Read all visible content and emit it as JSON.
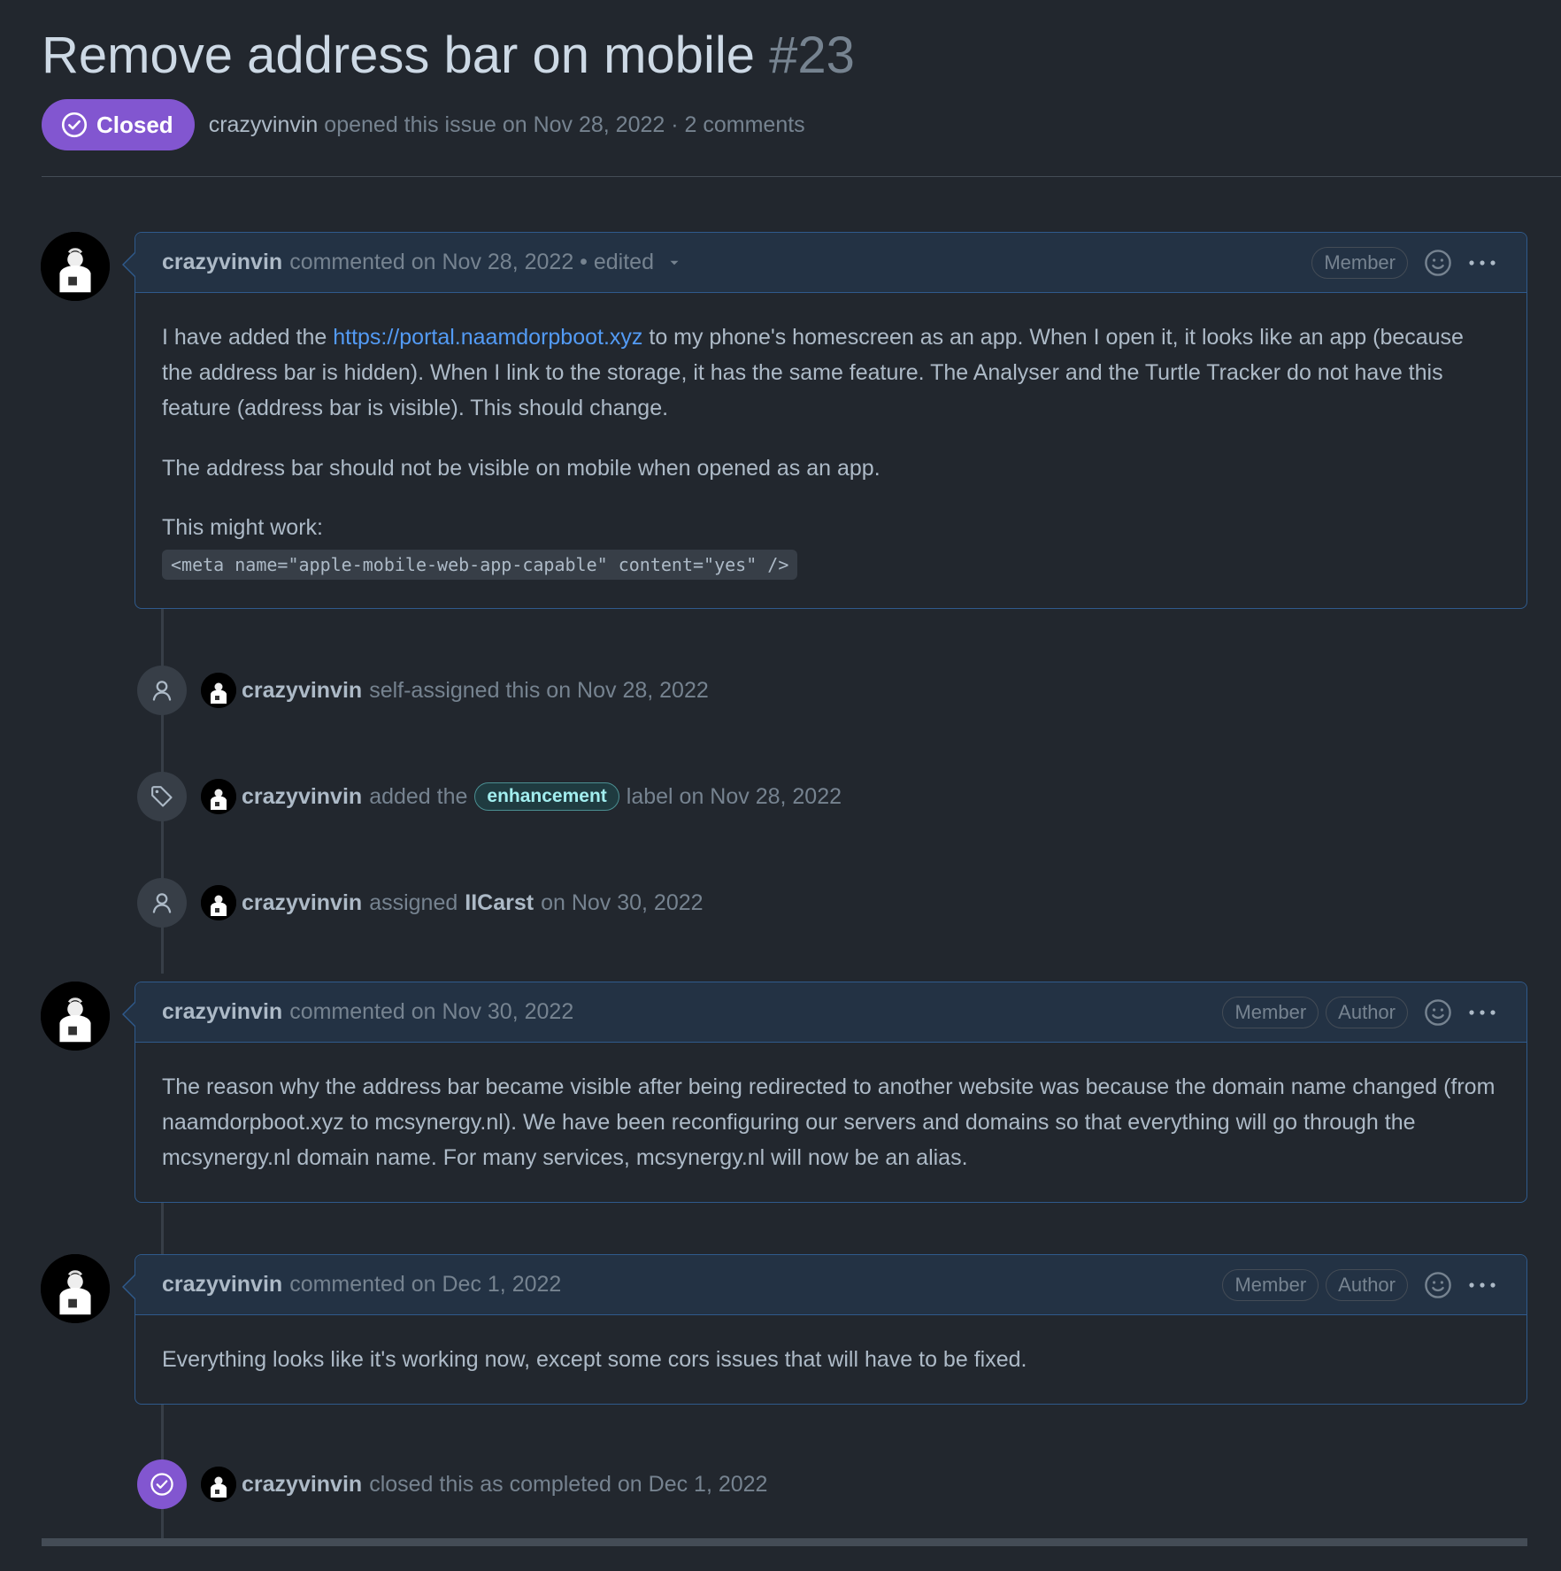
{
  "issue": {
    "title": "Remove address bar on mobile",
    "number": "#23",
    "state": "Closed",
    "author": "crazyvinvin",
    "meta": "opened this issue on Nov 28, 2022 · 2 comments"
  },
  "comments": [
    {
      "author": "crazyvinvin",
      "timestamp": "commented on Nov 28, 2022 • edited",
      "roles": [
        "Member"
      ],
      "body": {
        "p1_before": "I have added the ",
        "link": "https://portal.naamdorpboot.xyz",
        "p1_after": " to my phone's homescreen as an app. When I open it, it looks like an app (because the address bar is hidden). When I link to the storage, it has the same feature. The Analyser and the Turtle Tracker do not have this feature (address bar is visible). This should change.",
        "p2": "The address bar should not be visible on mobile when opened as an app.",
        "p3": "This might work:",
        "code": "<meta name=\"apple-mobile-web-app-capable\" content=\"yes\" />"
      }
    },
    {
      "author": "crazyvinvin",
      "timestamp": "commented on Nov 30, 2022",
      "roles": [
        "Member",
        "Author"
      ],
      "body": "The reason why the address bar became visible after being redirected to another website was because the domain name changed (from naamdorpboot.xyz to mcsynergy.nl). We have been reconfiguring our servers and domains so that everything will go through the mcsynergy.nl domain name. For many services, mcsynergy.nl will now be an alias."
    },
    {
      "author": "crazyvinvin",
      "timestamp": "commented on Dec 1, 2022",
      "roles": [
        "Member",
        "Author"
      ],
      "body": "Everything looks like it's working now, except some cors issues that will have to be fixed."
    }
  ],
  "events": [
    {
      "icon": "person-icon",
      "actor": "crazyvinvin",
      "text": "self-assigned this on Nov 28, 2022"
    },
    {
      "icon": "tag-icon",
      "actor": "crazyvinvin",
      "before": "added the",
      "label": "enhancement",
      "after": "label on Nov 28, 2022"
    },
    {
      "icon": "person-icon",
      "actor": "crazyvinvin",
      "before": "assigned",
      "assignee": "IICarst",
      "after": "on Nov 30, 2022"
    },
    {
      "icon": "check-circle-icon",
      "actor": "crazyvinvin",
      "text": "closed this as completed on Dec 1, 2022"
    }
  ],
  "colors": {
    "background": "#22272e",
    "closed_purple": "#8256d0",
    "link": "#539bf5",
    "comment_header": "#233244",
    "label": "#a2eeef"
  }
}
